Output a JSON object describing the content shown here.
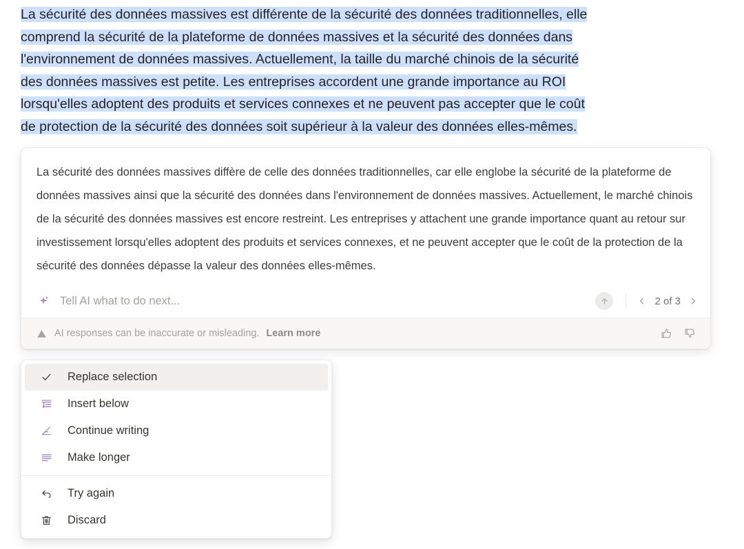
{
  "selection": {
    "lines": [
      "La sécurité des données massives est différente de la sécurité des données traditionnelles, elle",
      "comprend la sécurité de la plateforme de données massives et la sécurité des données dans",
      "l'environnement de données massives. Actuellement, la taille du marché chinois de la sécurité",
      "des données massives est petite. Les entreprises accordent une grande importance au ROI",
      "lorsqu'elles adoptent des produits et services connexes et ne peuvent pas accepter que le coût",
      "de protection de la sécurité des données soit supérieur à la valeur des données elles-mêmes."
    ],
    "highlight_color": "#cddffa"
  },
  "ai_card": {
    "response_text": "La sécurité des données massives diffère de celle des données traditionnelles, car elle englobe la sécurité de la plateforme de données massives ainsi que la sécurité des données dans l'environnement de données massives. Actuellement, le marché chinois de la sécurité des données massives est encore restreint. Les entreprises y attachent une grande importance quant au retour sur investissement lorsqu'elles adoptent des produits et services connexes, et ne peuvent accepter que le coût de la protection de la sécurité des données dépasse la valeur des données elles-mêmes.",
    "prompt": {
      "icon": "sparkle-icon",
      "placeholder": "Tell AI what to do next...",
      "value": "",
      "submit_icon": "arrow-up-circle-icon"
    },
    "pagination": {
      "prev_icon": "chevron-left-icon",
      "label": "2 of 3",
      "next_icon": "chevron-right-icon",
      "current": 2,
      "total": 3
    },
    "footer": {
      "warning_icon": "warning-triangle-icon",
      "disclaimer": "AI responses can be inaccurate or misleading.",
      "learn_more": "Learn more",
      "thumbs_up_icon": "thumbs-up-icon",
      "thumbs_down_icon": "thumbs-down-icon"
    },
    "accent_color": "#9c7fc3"
  },
  "action_menu": {
    "groups": [
      {
        "items": [
          {
            "label": "Replace selection",
            "icon": "check-icon",
            "icon_tone": "dark",
            "selected": true
          },
          {
            "label": "Insert below",
            "icon": "insert-below-icon",
            "icon_tone": "purple",
            "selected": false
          },
          {
            "label": "Continue writing",
            "icon": "pencil-icon",
            "icon_tone": "purple",
            "selected": false
          },
          {
            "label": "Make longer",
            "icon": "make-longer-icon",
            "icon_tone": "purple",
            "selected": false
          }
        ]
      },
      {
        "items": [
          {
            "label": "Try again",
            "icon": "undo-arrow-icon",
            "icon_tone": "dark",
            "selected": false
          },
          {
            "label": "Discard",
            "icon": "trash-icon",
            "icon_tone": "dark",
            "selected": false
          }
        ]
      }
    ]
  }
}
